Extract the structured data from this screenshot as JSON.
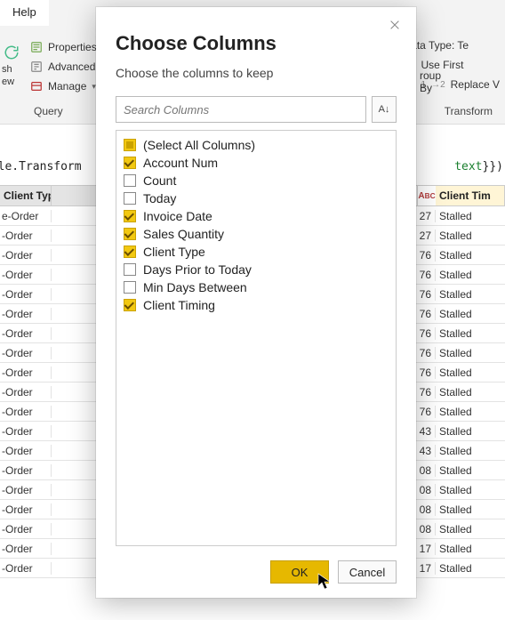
{
  "ribbon": {
    "help_tab": "Help",
    "properties": "Properties",
    "advanced": "Advanced",
    "manage": "Manage",
    "refresh_part": "sh",
    "preview_part": "ew",
    "query_group": "Query",
    "data_type": "Data Type: Te",
    "use_first": "Use First",
    "replace": "Replace V",
    "transform_group": "Transform",
    "group_by_1": "roup",
    "group_by_2": "By"
  },
  "formula": {
    "left": "able.Transform",
    "right_type": "text",
    "right_tail": "}})"
  },
  "grid": {
    "header_left": "Client Type",
    "header_right": "Client Tim",
    "abc": "A B C",
    "rows": [
      {
        "left": "e-Order",
        "mid": "27",
        "right": "Stalled"
      },
      {
        "left": "-Order",
        "mid": "27",
        "right": "Stalled"
      },
      {
        "left": "-Order",
        "mid": "76",
        "right": "Stalled"
      },
      {
        "left": "-Order",
        "mid": "76",
        "right": "Stalled"
      },
      {
        "left": "-Order",
        "mid": "76",
        "right": "Stalled"
      },
      {
        "left": "-Order",
        "mid": "76",
        "right": "Stalled"
      },
      {
        "left": "-Order",
        "mid": "76",
        "right": "Stalled"
      },
      {
        "left": "-Order",
        "mid": "76",
        "right": "Stalled"
      },
      {
        "left": "-Order",
        "mid": "76",
        "right": "Stalled"
      },
      {
        "left": "-Order",
        "mid": "76",
        "right": "Stalled"
      },
      {
        "left": "-Order",
        "mid": "76",
        "right": "Stalled"
      },
      {
        "left": "-Order",
        "mid": "43",
        "right": "Stalled"
      },
      {
        "left": "-Order",
        "mid": "43",
        "right": "Stalled"
      },
      {
        "left": "-Order",
        "mid": "08",
        "right": "Stalled"
      },
      {
        "left": "-Order",
        "mid": "08",
        "right": "Stalled"
      },
      {
        "left": "-Order",
        "mid": "08",
        "right": "Stalled"
      },
      {
        "left": "-Order",
        "mid": "08",
        "right": "Stalled"
      },
      {
        "left": "-Order",
        "mid": "17",
        "right": "Stalled"
      },
      {
        "left": "-Order",
        "mid": "17",
        "right": "Stalled"
      }
    ]
  },
  "dialog": {
    "title": "Choose Columns",
    "subtitle": "Choose the columns to keep",
    "search_placeholder": "Search Columns",
    "sort_label": "A↓Z↓",
    "ok": "OK",
    "cancel": "Cancel",
    "columns": [
      {
        "label": "(Select All Columns)",
        "state": "mixed"
      },
      {
        "label": "Account Num",
        "state": "checked"
      },
      {
        "label": "Count",
        "state": "unchecked"
      },
      {
        "label": "Today",
        "state": "unchecked"
      },
      {
        "label": "Invoice Date",
        "state": "checked"
      },
      {
        "label": "Sales Quantity",
        "state": "checked"
      },
      {
        "label": "Client Type",
        "state": "checked"
      },
      {
        "label": "Days Prior to Today",
        "state": "unchecked"
      },
      {
        "label": "Min Days Between",
        "state": "unchecked"
      },
      {
        "label": "Client Timing",
        "state": "checked"
      }
    ]
  }
}
